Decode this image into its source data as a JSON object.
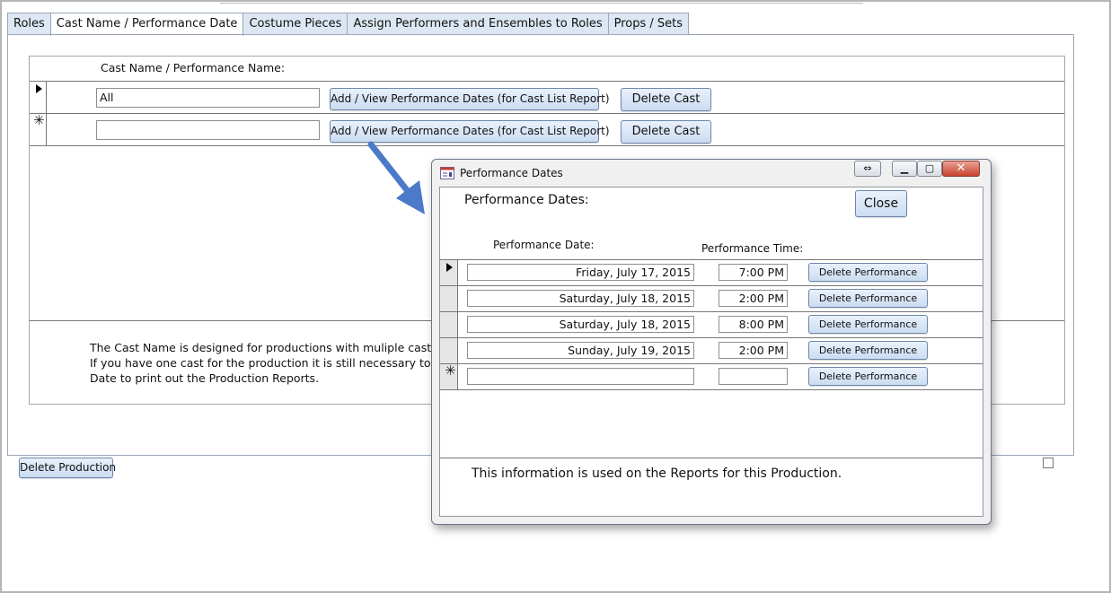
{
  "tabs": [
    {
      "label": "Roles",
      "active": false
    },
    {
      "label": "Cast Name / Performance Date",
      "active": true
    },
    {
      "label": "Costume Pieces",
      "active": false
    },
    {
      "label": "Assign Performers and Ensembles to Roles",
      "active": false
    },
    {
      "label": "Props / Sets",
      "active": false
    }
  ],
  "cast_form": {
    "header_label": "Cast Name / Performance Name:",
    "rows": [
      {
        "cast_name": "All",
        "view_dates_label": "Add / View Performance Dates (for Cast List Report)",
        "delete_label": "Delete Cast"
      },
      {
        "cast_name": "",
        "view_dates_label": "Add / View Performance Dates (for Cast List Report)",
        "delete_label": "Delete Cast"
      }
    ],
    "new_record_marker": "✳",
    "note_lines": [
      "The Cast Name is designed for productions with muliple casts (i.e",
      "If you have one cast for the production it is still necessary to put i",
      "Date to print out the Production Reports."
    ]
  },
  "delete_production_label": "Delete Production",
  "popup": {
    "title": "Performance Dates",
    "heading": "Performance Dates:",
    "close_label": "Close",
    "col_date": "Performance Date:",
    "col_time": "Performance Time:",
    "rows": [
      {
        "date": "Friday, July 17, 2015",
        "time": "7:00 PM",
        "delete_label": "Delete Performance"
      },
      {
        "date": "Saturday, July 18, 2015",
        "time": "2:00 PM",
        "delete_label": "Delete Performance"
      },
      {
        "date": "Saturday, July 18, 2015",
        "time": "8:00 PM",
        "delete_label": "Delete Performance"
      },
      {
        "date": "Sunday, July 19, 2015",
        "time": "2:00 PM",
        "delete_label": "Delete Performance"
      },
      {
        "date": "",
        "time": "",
        "delete_label": "Delete Performance"
      }
    ],
    "footer_text": "This information is used on the Reports for this Production."
  },
  "colors": {
    "accent_arrow": "#4a7ac8",
    "tab_bg": "#dde7f3",
    "button_bg": "#cbdcf1",
    "close_red": "#c9432e"
  }
}
